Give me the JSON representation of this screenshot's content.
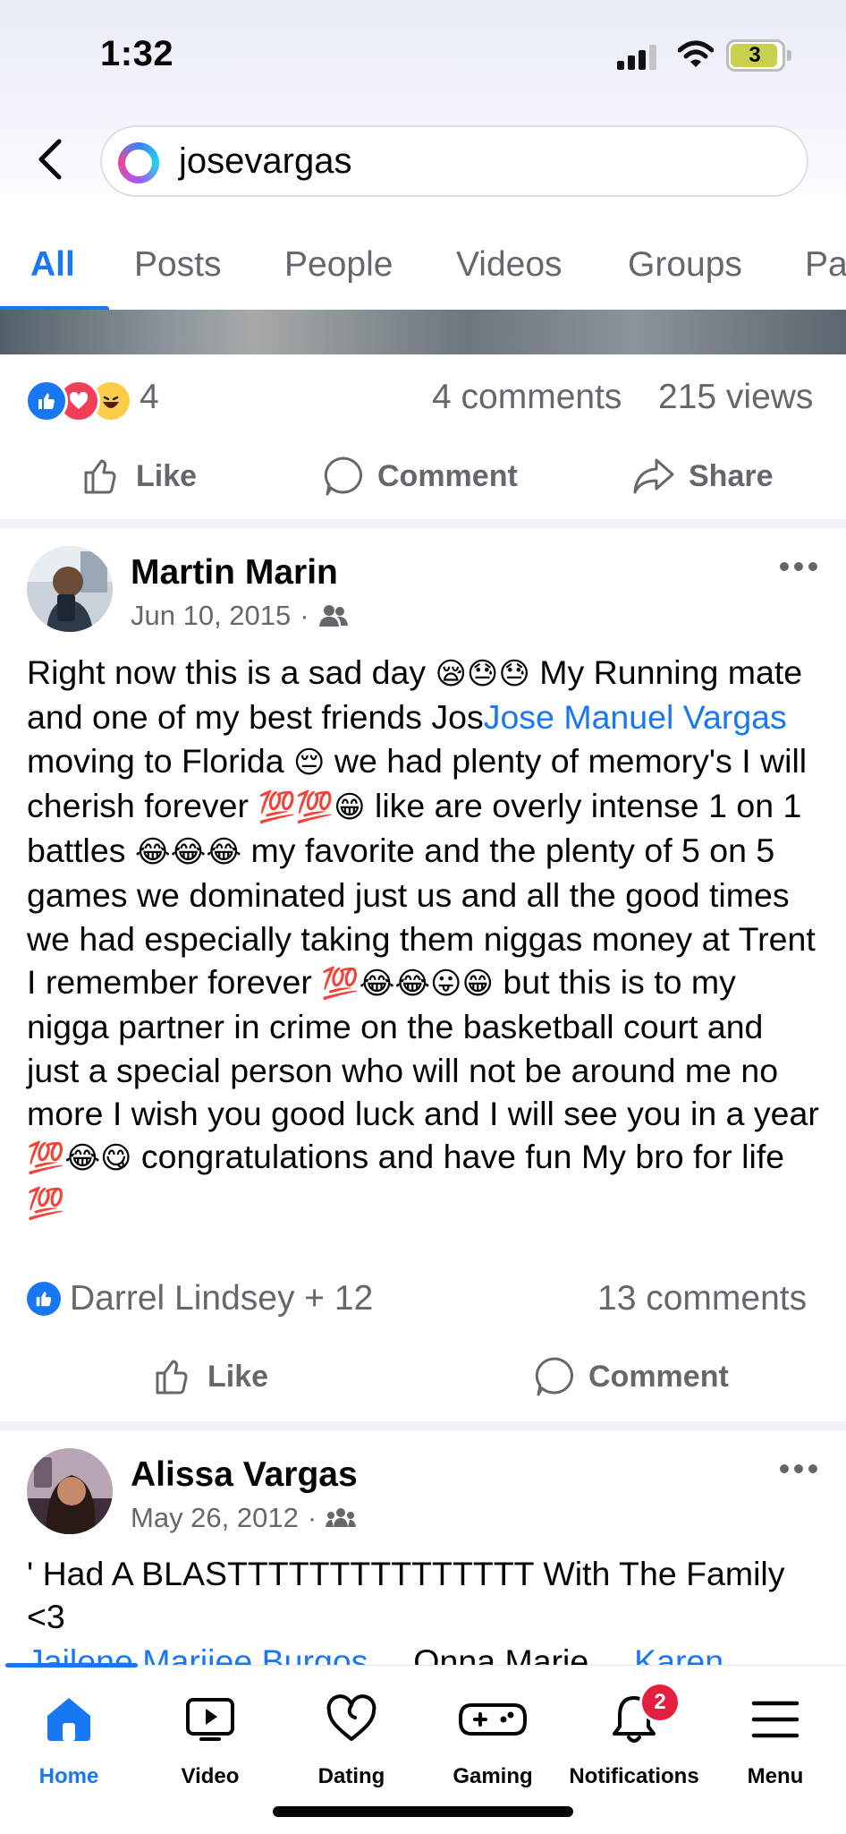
{
  "status_bar": {
    "time": "1:32",
    "battery": "3"
  },
  "search": {
    "query": "josevargas"
  },
  "tabs": [
    {
      "label": "All"
    },
    {
      "label": "Posts"
    },
    {
      "label": "People"
    },
    {
      "label": "Videos"
    },
    {
      "label": "Groups"
    },
    {
      "label": "Pa"
    }
  ],
  "top_post": {
    "reaction_count": "4",
    "comments": "4 comments",
    "views": "215 views",
    "actions": {
      "like": "Like",
      "comment": "Comment",
      "share": "Share"
    }
  },
  "post1": {
    "author": "Martin Marin",
    "date": "Jun 10, 2015",
    "text_part1": "Right now this is a sad day ",
    "emoji1": "😪😓😓",
    "text_part2": " My Running mate and one of my best friends Jos",
    "mention": "Jose Manuel Vargas",
    "text_part3": " moving to Florida ",
    "emoji2": "😔",
    "text_part4": " we had plenty of memory's I will cherish forever ",
    "emoji3": "💯💯😁",
    "text_part5": " like are overly intense 1 on 1 battles ",
    "emoji4": "😂😂😂",
    "text_part6": " my favorite and the plenty of 5 on 5 games we dominated just us and all the good times we had especially taking them niggas money at Trent I remember forever ",
    "emoji5": "💯😂😂😛😁",
    "text_part7": " but this is to my nigga partner in crime on the basketball court and just a special person who will not be around me no more I wish you good luck and I will see you in a year ",
    "emoji6": "💯😂😋",
    "text_part8": " congratulations and have fun My bro for life ",
    "emoji7": "💯",
    "reactions_label": "Darrel Lindsey + 12",
    "comments": "13 comments",
    "actions": {
      "like": "Like",
      "comment": "Comment"
    }
  },
  "post2": {
    "author": "Alissa Vargas",
    "date": "May 26, 2012",
    "text": "' Had A BLASTTTTTTTTTTTTTTT With The Family <3",
    "tag1": "Jailene Mariiee Burgos",
    "tag2": "Onna Marie",
    "tag3": "Karen"
  },
  "bottom_nav": [
    {
      "label": "Home",
      "icon": "home-icon"
    },
    {
      "label": "Video",
      "icon": "video-icon"
    },
    {
      "label": "Dating",
      "icon": "dating-icon"
    },
    {
      "label": "Gaming",
      "icon": "gaming-icon"
    },
    {
      "label": "Notifications",
      "icon": "bell-icon",
      "badge": "2"
    },
    {
      "label": "Menu",
      "icon": "menu-icon"
    }
  ],
  "colors": {
    "accent": "#1877f2",
    "badge": "#e41e3f",
    "secondary_text": "#65676b"
  }
}
